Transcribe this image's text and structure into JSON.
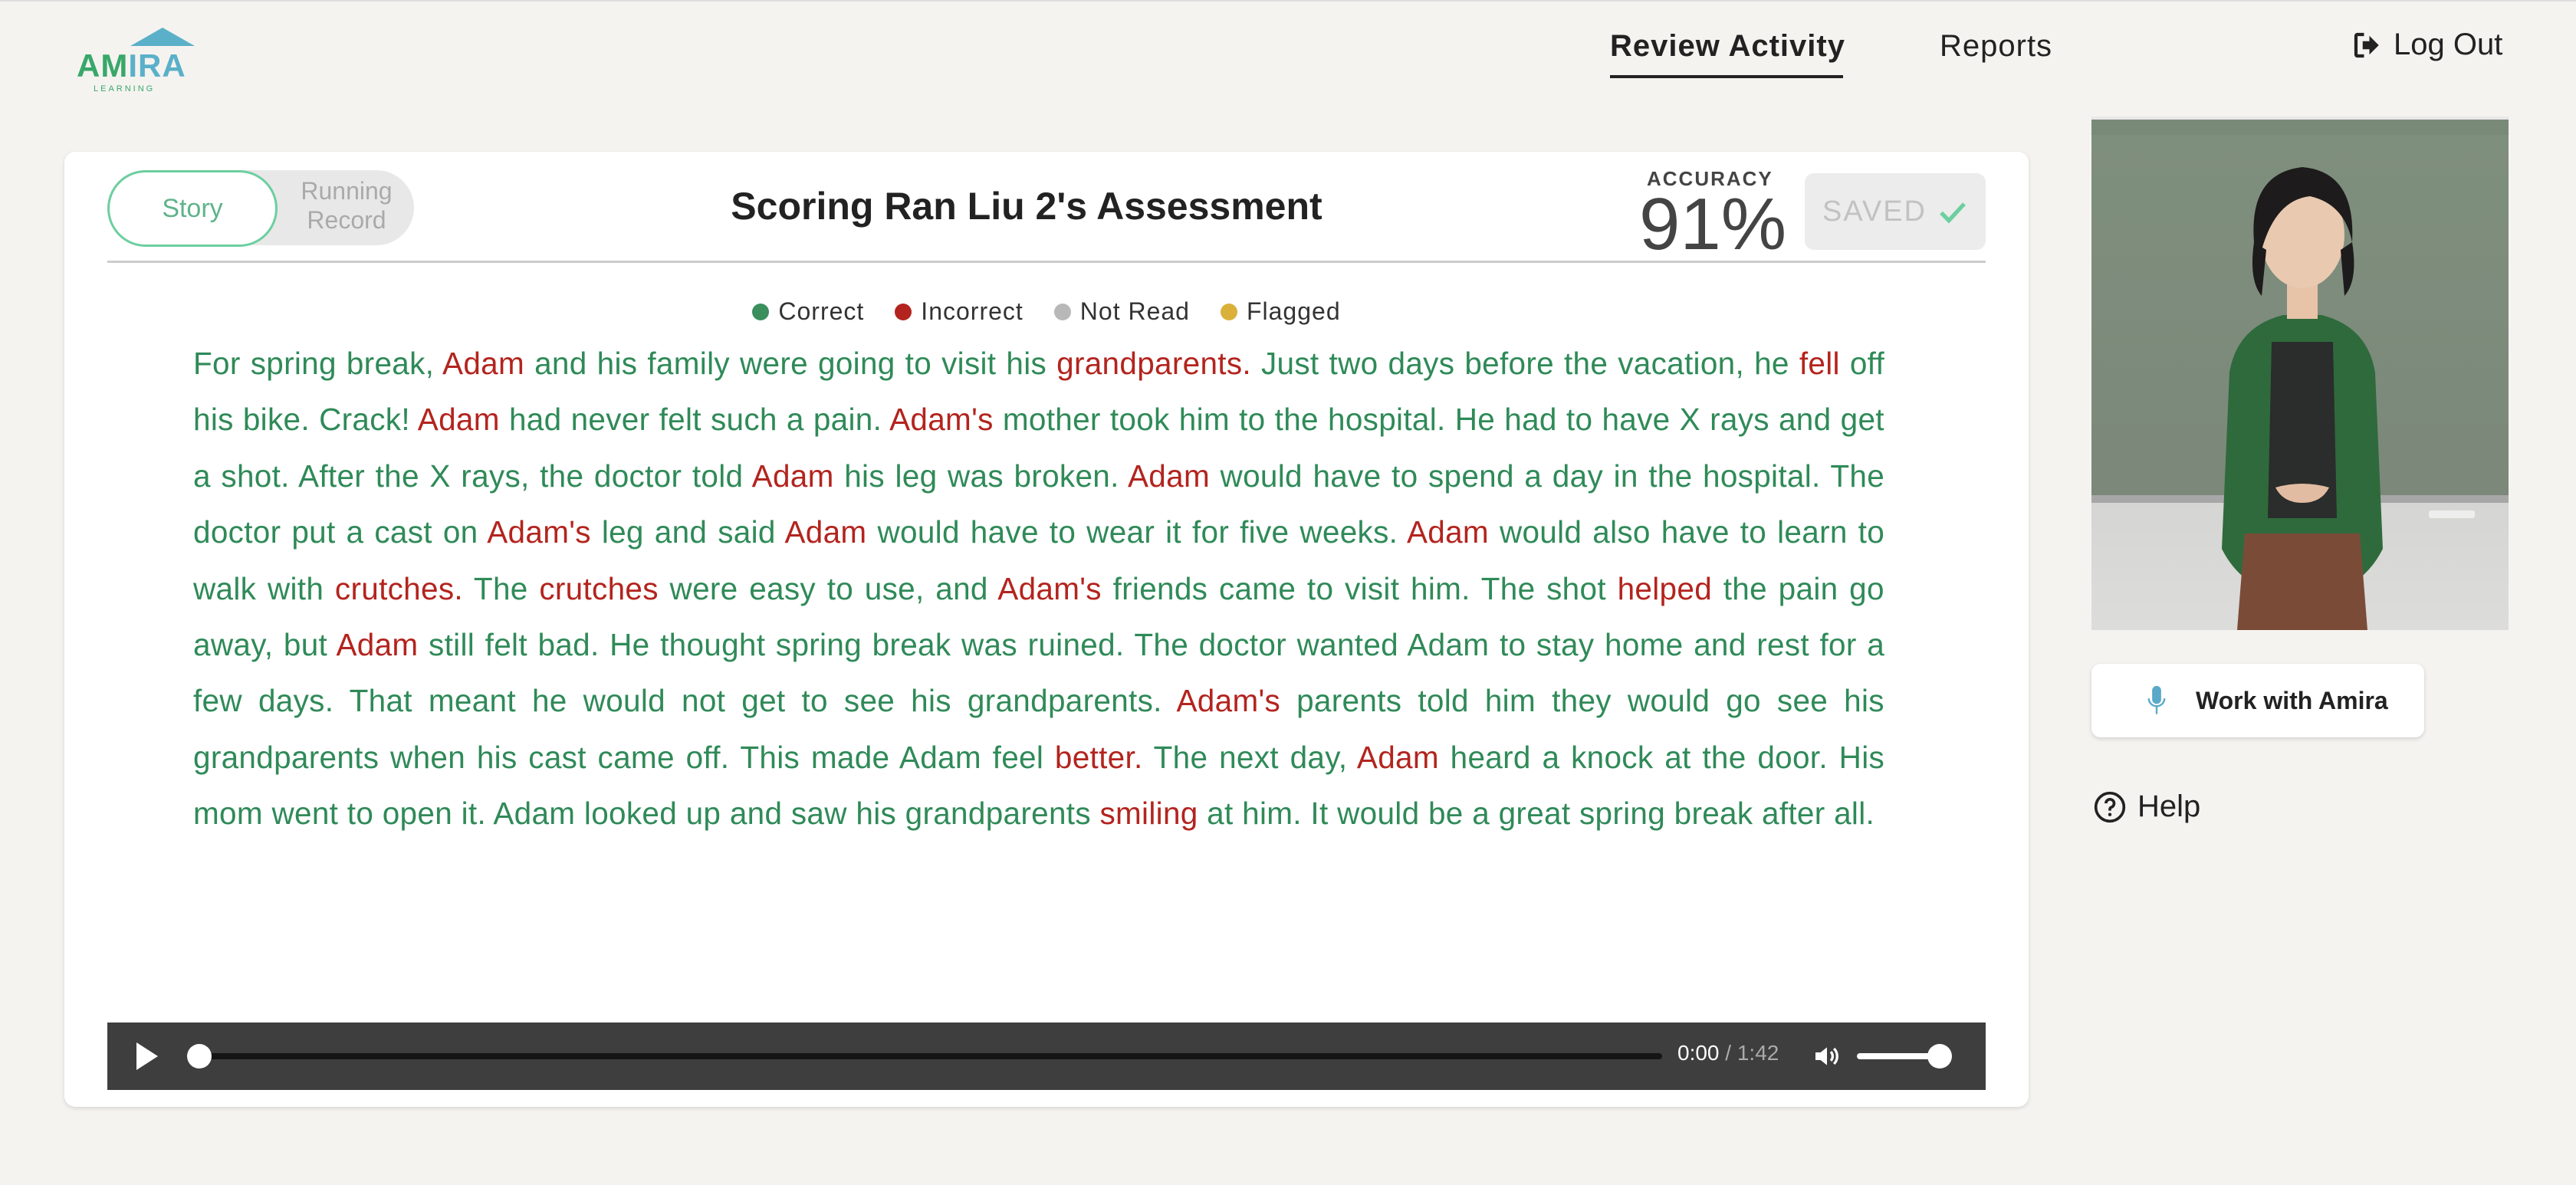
{
  "logo": {
    "text_am": "AM",
    "text_ira": "IRA",
    "subtext": "LEARNING"
  },
  "nav": {
    "review_activity": "Review Activity",
    "reports": "Reports",
    "logout": "Log Out"
  },
  "card": {
    "toggle": {
      "story": "Story",
      "running_record": "Running Record"
    },
    "title": "Scoring Ran Liu 2's Assessment",
    "accuracy_label": "ACCURACY",
    "accuracy_value": "91%",
    "saved_label": "SAVED"
  },
  "legend": [
    {
      "label": "Correct",
      "color": "#3a8f5c"
    },
    {
      "label": "Incorrect",
      "color": "#b3241e"
    },
    {
      "label": "Not Read",
      "color": "#b8b8b8"
    },
    {
      "label": "Flagged",
      "color": "#d9b13a"
    }
  ],
  "colors": {
    "correct": "#2f8a58",
    "incorrect": "#b3241e",
    "accent": "#6ccf9f"
  },
  "story_words": [
    {
      "t": "For",
      "s": "c"
    },
    {
      "t": "spring",
      "s": "c"
    },
    {
      "t": "break,",
      "s": "c"
    },
    {
      "t": "Adam",
      "s": "i"
    },
    {
      "t": "and",
      "s": "c"
    },
    {
      "t": "his",
      "s": "c"
    },
    {
      "t": "family",
      "s": "c"
    },
    {
      "t": "were",
      "s": "c"
    },
    {
      "t": "going",
      "s": "c"
    },
    {
      "t": "to",
      "s": "c"
    },
    {
      "t": "visit",
      "s": "c"
    },
    {
      "t": "his",
      "s": "c"
    },
    {
      "t": "grandparents.",
      "s": "i"
    },
    {
      "t": "Just",
      "s": "c"
    },
    {
      "t": "two",
      "s": "c"
    },
    {
      "t": "days",
      "s": "c"
    },
    {
      "t": "before",
      "s": "c"
    },
    {
      "t": "the",
      "s": "c"
    },
    {
      "t": "vacation,",
      "s": "c"
    },
    {
      "t": "he",
      "s": "c"
    },
    {
      "t": "fell",
      "s": "i"
    },
    {
      "t": "off",
      "s": "c"
    },
    {
      "t": "his",
      "s": "c"
    },
    {
      "t": "bike.",
      "s": "c"
    },
    {
      "t": "Crack!",
      "s": "c"
    },
    {
      "t": "Adam",
      "s": "i"
    },
    {
      "t": "had",
      "s": "c"
    },
    {
      "t": "never",
      "s": "c"
    },
    {
      "t": "felt",
      "s": "c"
    },
    {
      "t": "such",
      "s": "c"
    },
    {
      "t": "a",
      "s": "c"
    },
    {
      "t": "pain.",
      "s": "c"
    },
    {
      "t": "Adam's",
      "s": "i"
    },
    {
      "t": "mother",
      "s": "c"
    },
    {
      "t": "took",
      "s": "c"
    },
    {
      "t": "him",
      "s": "c"
    },
    {
      "t": "to",
      "s": "c"
    },
    {
      "t": "the",
      "s": "c"
    },
    {
      "t": "hospital.",
      "s": "c"
    },
    {
      "t": "He",
      "s": "c"
    },
    {
      "t": "had",
      "s": "c"
    },
    {
      "t": "to",
      "s": "c"
    },
    {
      "t": "have",
      "s": "c"
    },
    {
      "t": "X",
      "s": "c"
    },
    {
      "t": "rays",
      "s": "c"
    },
    {
      "t": "and",
      "s": "c"
    },
    {
      "t": "get",
      "s": "c"
    },
    {
      "t": "a",
      "s": "c"
    },
    {
      "t": "shot.",
      "s": "c"
    },
    {
      "t": "After",
      "s": "c"
    },
    {
      "t": "the",
      "s": "c"
    },
    {
      "t": "X",
      "s": "c"
    },
    {
      "t": "rays,",
      "s": "c"
    },
    {
      "t": "the",
      "s": "c"
    },
    {
      "t": "doctor",
      "s": "c"
    },
    {
      "t": "told",
      "s": "c"
    },
    {
      "t": "Adam",
      "s": "i"
    },
    {
      "t": "his",
      "s": "c"
    },
    {
      "t": "leg",
      "s": "c"
    },
    {
      "t": "was",
      "s": "c"
    },
    {
      "t": "broken.",
      "s": "c"
    },
    {
      "t": "Adam",
      "s": "i"
    },
    {
      "t": "would",
      "s": "c"
    },
    {
      "t": "have",
      "s": "c"
    },
    {
      "t": "to",
      "s": "c"
    },
    {
      "t": "spend",
      "s": "c"
    },
    {
      "t": "a",
      "s": "c"
    },
    {
      "t": "day",
      "s": "c"
    },
    {
      "t": "in",
      "s": "c"
    },
    {
      "t": "the",
      "s": "c"
    },
    {
      "t": "hospital.",
      "s": "c"
    },
    {
      "t": "The",
      "s": "c"
    },
    {
      "t": "doctor",
      "s": "c"
    },
    {
      "t": "put",
      "s": "c"
    },
    {
      "t": "a",
      "s": "c"
    },
    {
      "t": "cast",
      "s": "c"
    },
    {
      "t": "on",
      "s": "c"
    },
    {
      "t": "Adam's",
      "s": "i"
    },
    {
      "t": "leg",
      "s": "c"
    },
    {
      "t": "and",
      "s": "c"
    },
    {
      "t": "said",
      "s": "c"
    },
    {
      "t": "Adam",
      "s": "i"
    },
    {
      "t": "would",
      "s": "c"
    },
    {
      "t": "have",
      "s": "c"
    },
    {
      "t": "to",
      "s": "c"
    },
    {
      "t": "wear",
      "s": "c"
    },
    {
      "t": "it",
      "s": "c"
    },
    {
      "t": "for",
      "s": "c"
    },
    {
      "t": "five",
      "s": "c"
    },
    {
      "t": "weeks.",
      "s": "c"
    },
    {
      "t": "Adam",
      "s": "i"
    },
    {
      "t": "would",
      "s": "c"
    },
    {
      "t": "also",
      "s": "c"
    },
    {
      "t": "have",
      "s": "c"
    },
    {
      "t": "to",
      "s": "c"
    },
    {
      "t": "learn",
      "s": "c"
    },
    {
      "t": "to",
      "s": "c"
    },
    {
      "t": "walk",
      "s": "c"
    },
    {
      "t": "with",
      "s": "c"
    },
    {
      "t": "crutches.",
      "s": "i"
    },
    {
      "t": "The",
      "s": "c"
    },
    {
      "t": "crutches",
      "s": "i"
    },
    {
      "t": "were",
      "s": "c"
    },
    {
      "t": "easy",
      "s": "c"
    },
    {
      "t": "to",
      "s": "c"
    },
    {
      "t": "use,",
      "s": "c"
    },
    {
      "t": "and",
      "s": "c"
    },
    {
      "t": "Adam's",
      "s": "i"
    },
    {
      "t": "friends",
      "s": "c"
    },
    {
      "t": "came",
      "s": "c"
    },
    {
      "t": "to",
      "s": "c"
    },
    {
      "t": "visit",
      "s": "c"
    },
    {
      "t": "him.",
      "s": "c"
    },
    {
      "t": "The",
      "s": "c"
    },
    {
      "t": "shot",
      "s": "c"
    },
    {
      "t": "helped",
      "s": "i"
    },
    {
      "t": "the",
      "s": "c"
    },
    {
      "t": "pain",
      "s": "c"
    },
    {
      "t": "go",
      "s": "c"
    },
    {
      "t": "away,",
      "s": "c"
    },
    {
      "t": "but",
      "s": "c"
    },
    {
      "t": "Adam",
      "s": "i"
    },
    {
      "t": "still",
      "s": "c"
    },
    {
      "t": "felt",
      "s": "c"
    },
    {
      "t": "bad.",
      "s": "c"
    },
    {
      "t": "He",
      "s": "c"
    },
    {
      "t": "thought",
      "s": "c"
    },
    {
      "t": "spring",
      "s": "c"
    },
    {
      "t": "break",
      "s": "c"
    },
    {
      "t": "was",
      "s": "c"
    },
    {
      "t": "ruined.",
      "s": "c"
    },
    {
      "t": "The",
      "s": "c"
    },
    {
      "t": "doctor",
      "s": "c"
    },
    {
      "t": "wanted",
      "s": "c"
    },
    {
      "t": "Adam",
      "s": "c"
    },
    {
      "t": "to",
      "s": "c"
    },
    {
      "t": "stay",
      "s": "c"
    },
    {
      "t": "home",
      "s": "c"
    },
    {
      "t": "and",
      "s": "c"
    },
    {
      "t": "rest",
      "s": "c"
    },
    {
      "t": "for",
      "s": "c"
    },
    {
      "t": "a",
      "s": "c"
    },
    {
      "t": "few",
      "s": "c"
    },
    {
      "t": "days.",
      "s": "c"
    },
    {
      "t": "That",
      "s": "c"
    },
    {
      "t": "meant",
      "s": "c"
    },
    {
      "t": "he",
      "s": "c"
    },
    {
      "t": "would",
      "s": "c"
    },
    {
      "t": "not",
      "s": "c"
    },
    {
      "t": "get",
      "s": "c"
    },
    {
      "t": "to",
      "s": "c"
    },
    {
      "t": "see",
      "s": "c"
    },
    {
      "t": "his",
      "s": "c"
    },
    {
      "t": "grandparents.",
      "s": "c"
    },
    {
      "t": "Adam's",
      "s": "i"
    },
    {
      "t": "parents",
      "s": "c"
    },
    {
      "t": "told",
      "s": "c"
    },
    {
      "t": "him",
      "s": "c"
    },
    {
      "t": "they",
      "s": "c"
    },
    {
      "t": "would",
      "s": "c"
    },
    {
      "t": "go",
      "s": "c"
    },
    {
      "t": "see",
      "s": "c"
    },
    {
      "t": "his",
      "s": "c"
    },
    {
      "t": "grandparents",
      "s": "c"
    },
    {
      "t": "when",
      "s": "c"
    },
    {
      "t": "his",
      "s": "c"
    },
    {
      "t": "cast",
      "s": "c"
    },
    {
      "t": "came",
      "s": "c"
    },
    {
      "t": "off.",
      "s": "c"
    },
    {
      "t": "This",
      "s": "c"
    },
    {
      "t": "made",
      "s": "c"
    },
    {
      "t": "Adam",
      "s": "c"
    },
    {
      "t": "feel",
      "s": "c"
    },
    {
      "t": "better.",
      "s": "i"
    },
    {
      "t": "The",
      "s": "c"
    },
    {
      "t": "next",
      "s": "c"
    },
    {
      "t": "day,",
      "s": "c"
    },
    {
      "t": "Adam",
      "s": "i"
    },
    {
      "t": "heard",
      "s": "c"
    },
    {
      "t": "a",
      "s": "c"
    },
    {
      "t": "knock",
      "s": "c"
    },
    {
      "t": "at",
      "s": "c"
    },
    {
      "t": "the",
      "s": "c"
    },
    {
      "t": "door.",
      "s": "c"
    },
    {
      "t": "His",
      "s": "c"
    },
    {
      "t": "mom",
      "s": "c"
    },
    {
      "t": "went",
      "s": "c"
    },
    {
      "t": "to",
      "s": "c"
    },
    {
      "t": "open",
      "s": "c"
    },
    {
      "t": "it.",
      "s": "c"
    },
    {
      "t": "Adam",
      "s": "c"
    },
    {
      "t": "looked",
      "s": "c"
    },
    {
      "t": "up",
      "s": "c"
    },
    {
      "t": "and",
      "s": "c"
    },
    {
      "t": "saw",
      "s": "c"
    },
    {
      "t": "his",
      "s": "c"
    },
    {
      "t": "grandparents",
      "s": "c"
    },
    {
      "t": "smiling",
      "s": "i"
    },
    {
      "t": "at",
      "s": "c"
    },
    {
      "t": "him.",
      "s": "c"
    },
    {
      "t": "It",
      "s": "c"
    },
    {
      "t": "would",
      "s": "c"
    },
    {
      "t": "be",
      "s": "c"
    },
    {
      "t": "a",
      "s": "c"
    },
    {
      "t": "great",
      "s": "c"
    },
    {
      "t": "spring",
      "s": "c"
    },
    {
      "t": "break",
      "s": "c"
    },
    {
      "t": "after",
      "s": "c"
    },
    {
      "t": "all.",
      "s": "c"
    }
  ],
  "audio": {
    "current": "0:00",
    "duration": "1:42",
    "progress": 0.0,
    "volume": 0.9
  },
  "side": {
    "work_button": "Work with Amira",
    "help": "Help"
  }
}
